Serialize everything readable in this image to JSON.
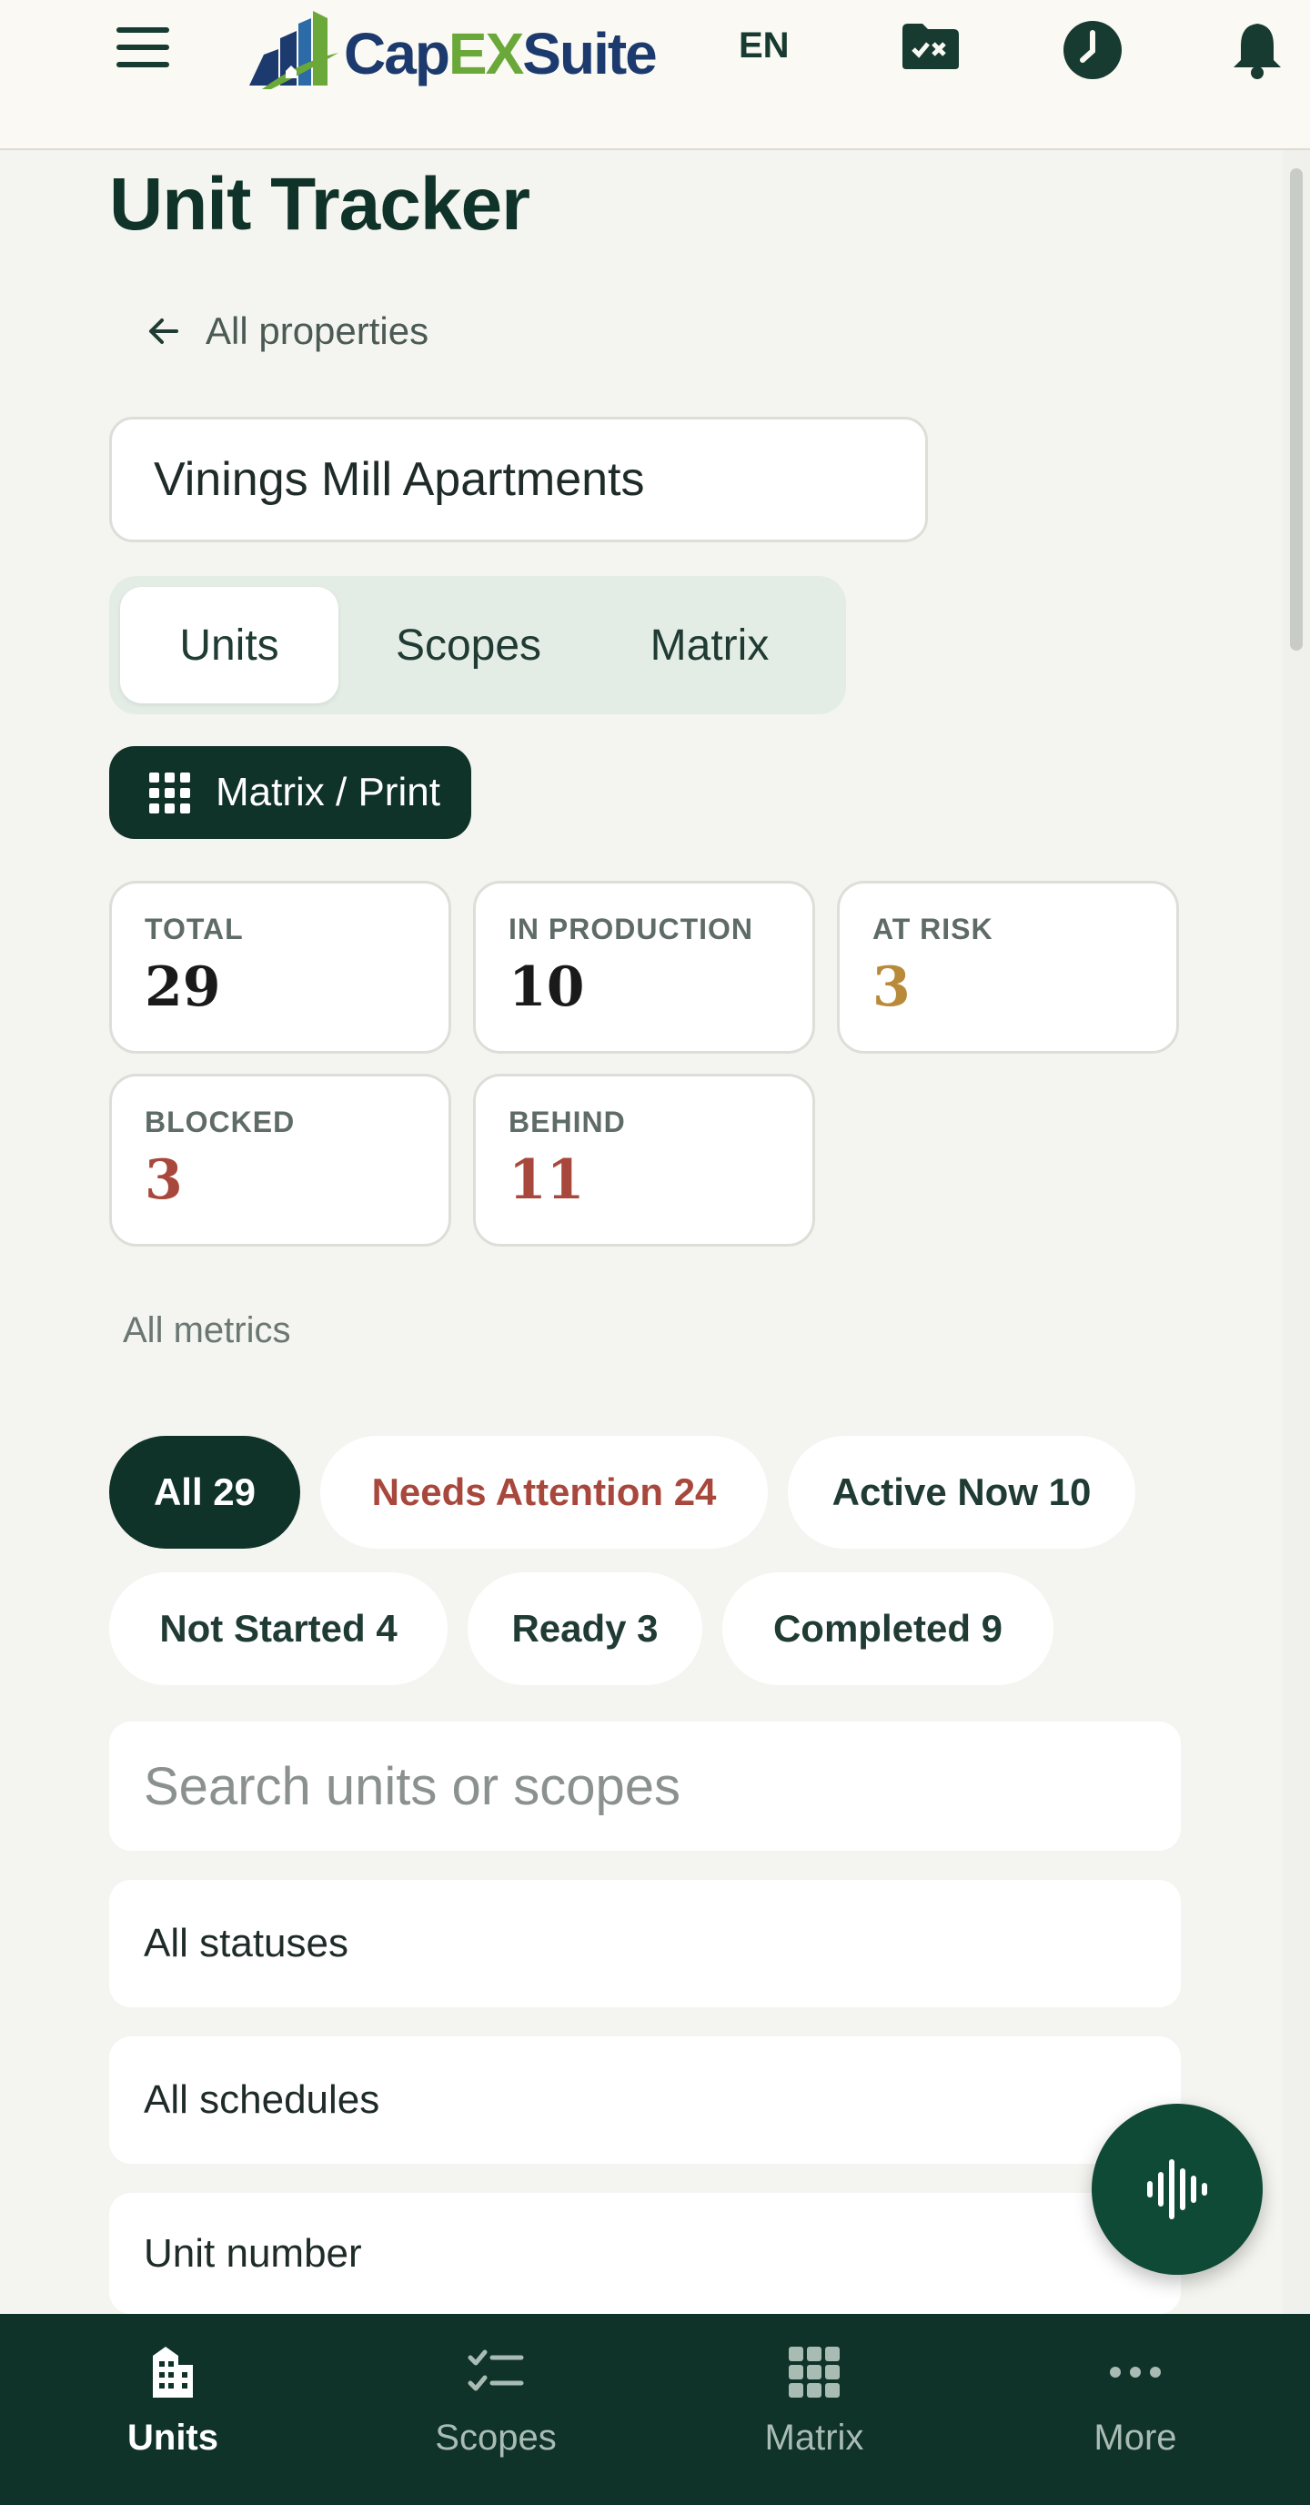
{
  "header": {
    "logo_prefix": "Cap",
    "logo_ex": "EX",
    "logo_suffix": "Suite",
    "language": "EN",
    "icons": [
      "menu-icon",
      "folder-check-icon",
      "clock-icon",
      "bell-icon"
    ]
  },
  "page": {
    "title": "Unit Tracker",
    "back_label": "All properties",
    "property": "Vinings Mill Apartments"
  },
  "tabs": [
    {
      "label": "Units",
      "active": true
    },
    {
      "label": "Scopes",
      "active": false
    },
    {
      "label": "Matrix",
      "active": false
    }
  ],
  "matrix_button": {
    "label": "Matrix / Print",
    "icon": "grid-icon"
  },
  "stats": [
    {
      "label": "TOTAL",
      "value": "29",
      "color": "#1a1a1a"
    },
    {
      "label": "IN PRODUCTION",
      "value": "10",
      "color": "#1a1a1a"
    },
    {
      "label": "AT RISK",
      "value": "3",
      "color": "#b88a3a"
    },
    {
      "label": "BLOCKED",
      "value": "3",
      "color": "#a8483c"
    },
    {
      "label": "BEHIND",
      "value": "11",
      "color": "#a8483c"
    }
  ],
  "all_metrics_label": "All metrics",
  "filters": [
    {
      "label": "All 29",
      "active": true
    },
    {
      "label": "Needs Attention 24",
      "alert": true
    },
    {
      "label": "Active Now 10"
    },
    {
      "label": "Not Started 4"
    },
    {
      "label": "Ready 3"
    },
    {
      "label": "Completed 9"
    }
  ],
  "search": {
    "placeholder": "Search units or scopes"
  },
  "selects": {
    "status": "All statuses",
    "schedule": "All schedules",
    "sort": "Unit number"
  },
  "bottom_nav": [
    {
      "label": "Units",
      "icon": "building-icon",
      "active": true
    },
    {
      "label": "Scopes",
      "icon": "checklist-icon"
    },
    {
      "label": "Matrix",
      "icon": "grid-icon"
    },
    {
      "label": "More",
      "icon": "more-icon"
    }
  ],
  "colors": {
    "primary": "#0f3229",
    "alert": "#a8483c",
    "warning": "#b88a3a",
    "background": "#f4f5f0"
  }
}
